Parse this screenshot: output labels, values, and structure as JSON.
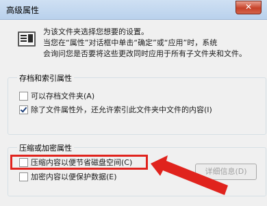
{
  "window": {
    "title": "高级属性",
    "close_glyph": "✕"
  },
  "description": {
    "line1": "为该文件夹选择您想要的设置。",
    "line2": "当您在“属性”对话框中单击“确定”或“应用”时，系统",
    "line3": "会询问您是否要将这些更改同时应用于所有子文件夹和文件。"
  },
  "archive_index": {
    "title": "存档和索引属性",
    "archive_label": "可以存档文件夹(A)",
    "archive_checked": false,
    "index_label": "除了文件属性外，还允许索引此文件夹中文件的内容(I)",
    "index_checked": true
  },
  "compress_encrypt": {
    "title": "压缩或加密属性",
    "compress_label": "压缩内容以便节省磁盘空间(C)",
    "compress_checked": false,
    "encrypt_label": "加密内容以便保护数据(E)",
    "encrypt_checked": false,
    "details_button": "详细信息(D)"
  },
  "annotation": {
    "color": "#e0231d"
  }
}
